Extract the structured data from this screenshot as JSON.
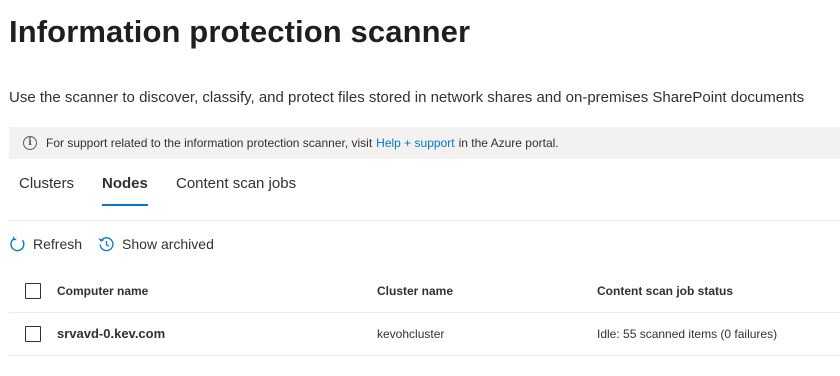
{
  "page": {
    "title": "Information protection scanner",
    "description": "Use the scanner to discover, classify, and protect files stored in network shares and on-premises SharePoint documents"
  },
  "info_bar": {
    "icon": "info-icon",
    "text_before": "For support related to the information protection scanner, visit",
    "link_text": "Help + support",
    "text_after": "in the Azure portal."
  },
  "tabs": [
    {
      "label": "Clusters",
      "active": false
    },
    {
      "label": "Nodes",
      "active": true
    },
    {
      "label": "Content scan jobs",
      "active": false
    }
  ],
  "toolbar": {
    "refresh_label": "Refresh",
    "refresh_icon": "refresh-icon",
    "show_archived_label": "Show archived",
    "show_archived_icon": "history-icon"
  },
  "grid": {
    "columns": [
      "Computer name",
      "Cluster name",
      "Content scan job status"
    ],
    "rows": [
      {
        "computer_name": "srvavd-0.kev.com",
        "cluster_name": "kevohcluster",
        "status": "Idle: 55 scanned items (0 failures)"
      }
    ]
  },
  "colors": {
    "accent": "#0078d4",
    "info_bar_bg": "#f3f2f1",
    "text": "#323130"
  }
}
